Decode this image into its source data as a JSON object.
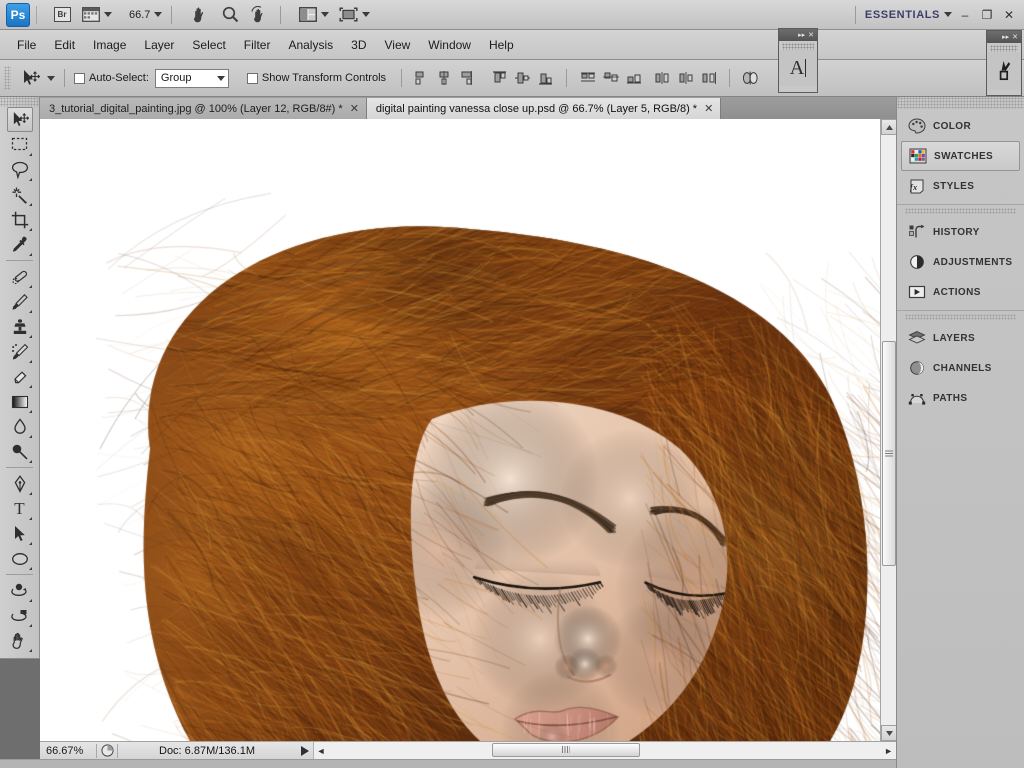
{
  "app": {
    "logo_text": "Ps",
    "bridge_label": "Br",
    "zoom_value": "66.7",
    "workspace_label": "ESSENTIALS",
    "window_minimize": "–",
    "window_restore": "❐",
    "window_close": "✕"
  },
  "menu": {
    "items": [
      "File",
      "Edit",
      "Image",
      "Layer",
      "Select",
      "Filter",
      "Analysis",
      "3D",
      "View",
      "Window",
      "Help"
    ]
  },
  "options": {
    "auto_select_label": "Auto-Select:",
    "auto_select_value": "Group",
    "show_transform_label": "Show Transform Controls",
    "align_icons": [
      "align-left-edges-icon",
      "align-horizontal-centers-icon",
      "align-right-edges-icon",
      "align-top-edges-icon",
      "align-vertical-centers-icon",
      "align-bottom-edges-icon",
      "distribute-top-edges-icon",
      "distribute-vertical-centers-icon",
      "distribute-bottom-edges-icon",
      "distribute-left-edges-icon",
      "distribute-horizontal-centers-icon",
      "distribute-right-edges-icon",
      "auto-align-layers-icon"
    ]
  },
  "mini_panels": [
    {
      "name": "character-panel",
      "glyph": "A",
      "expand": "▸▸",
      "close": "✕"
    },
    {
      "name": "brushes-panel",
      "glyph": "brush-icon",
      "expand": "▸▸",
      "close": "✕"
    }
  ],
  "tabs": [
    {
      "label": "3_tutorial_digital_painting.jpg @ 100% (Layer 12, RGB/8#) *",
      "close": "✕",
      "active": false
    },
    {
      "label": "digital painting vanessa close up.psd @ 66.7% (Layer 5, RGB/8) *",
      "close": "✕",
      "active": true
    }
  ],
  "toolbox": {
    "tools": [
      {
        "name": "move-tool",
        "active": true,
        "submenu": false
      },
      {
        "name": "rectangular-marquee-tool",
        "active": false,
        "submenu": true
      },
      {
        "name": "lasso-tool",
        "active": false,
        "submenu": true
      },
      {
        "name": "magic-wand-tool",
        "active": false,
        "submenu": true
      },
      {
        "name": "crop-tool",
        "active": false,
        "submenu": true
      },
      {
        "name": "eyedropper-tool",
        "active": false,
        "submenu": true
      },
      {
        "name": "healing-brush-tool",
        "active": false,
        "submenu": true
      },
      {
        "name": "brush-tool",
        "active": false,
        "submenu": true
      },
      {
        "name": "clone-stamp-tool",
        "active": false,
        "submenu": true
      },
      {
        "name": "history-brush-tool",
        "active": false,
        "submenu": true
      },
      {
        "name": "eraser-tool",
        "active": false,
        "submenu": true
      },
      {
        "name": "gradient-tool",
        "active": false,
        "submenu": true
      },
      {
        "name": "blur-tool",
        "active": false,
        "submenu": true
      },
      {
        "name": "dodge-tool",
        "active": false,
        "submenu": true
      },
      {
        "name": "pen-tool",
        "active": false,
        "submenu": true
      },
      {
        "name": "horizontal-type-tool",
        "active": false,
        "submenu": true
      },
      {
        "name": "path-selection-tool",
        "active": false,
        "submenu": true
      },
      {
        "name": "ellipse-shape-tool",
        "active": false,
        "submenu": true
      },
      {
        "name": "3d-rotate-tool",
        "active": false,
        "submenu": true
      },
      {
        "name": "3d-orbit-camera-tool",
        "active": false,
        "submenu": true
      },
      {
        "name": "hand-tool",
        "active": false,
        "submenu": true
      },
      {
        "name": "zoom-tool",
        "active": false,
        "submenu": false
      }
    ],
    "foreground_color": "#ee0000",
    "background_color": "#ffffff",
    "quick_mask_name": "quick-mask-mode-button"
  },
  "dock": {
    "groups": [
      {
        "items": [
          {
            "label": "COLOR",
            "icon": "color-palette-icon",
            "active": false
          },
          {
            "label": "SWATCHES",
            "icon": "swatches-grid-icon",
            "active": true
          },
          {
            "label": "STYLES",
            "icon": "styles-fx-icon",
            "active": false
          }
        ]
      },
      {
        "items": [
          {
            "label": "HISTORY",
            "icon": "history-undo-icon",
            "active": false
          },
          {
            "label": "ADJUSTMENTS",
            "icon": "adjustments-circle-icon",
            "active": false
          },
          {
            "label": "ACTIONS",
            "icon": "actions-play-icon",
            "active": false
          }
        ]
      },
      {
        "items": [
          {
            "label": "LAYERS",
            "icon": "layers-stack-icon",
            "active": false
          },
          {
            "label": "CHANNELS",
            "icon": "channels-sphere-icon",
            "active": false
          },
          {
            "label": "PATHS",
            "icon": "paths-anchor-icon",
            "active": false
          }
        ]
      }
    ]
  },
  "status": {
    "zoom_percent": "66.67%",
    "doc_info": "Doc: 6.87M/136.1M",
    "preview_icon": "document-thumb-icon",
    "play_icon": "status-menu-arrow-icon",
    "scroll_left_icon": "◄",
    "scroll_right_icon": "►"
  },
  "canvas": {
    "artwork_title": "digital painting vanessa close up",
    "description": "Digital painting portrait of a woman with long auburn hair, eyes closed, head tilted down, on white background",
    "background": "#ffffff",
    "hair_colors": [
      "#8a4513",
      "#a9581b",
      "#c87a28",
      "#6b3410",
      "#3b1c0a",
      "#d49a3c"
    ],
    "skin_colors": [
      "#f0d8c4",
      "#e3c1a8",
      "#d4a98c",
      "#c2907a"
    ],
    "lip_color": "#c98f7e"
  }
}
